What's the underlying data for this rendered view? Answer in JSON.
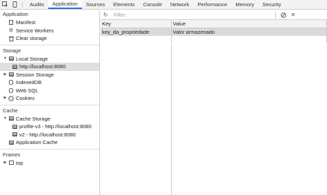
{
  "tabs": [
    "Audits",
    "Application",
    "Sources",
    "Elements",
    "Console",
    "Network",
    "Performance",
    "Memory",
    "Security"
  ],
  "active_tab": "Application",
  "icons": {
    "inspect": "inspect-element-icon",
    "device": "device-toolbar-icon",
    "refresh": "refresh-icon",
    "clear": "clear-block-icon",
    "delete": "close-icon"
  },
  "sidebar": {
    "application": {
      "title": "Application",
      "items": [
        "Manifest",
        "Service Workers",
        "Clear storage"
      ]
    },
    "storage": {
      "title": "Storage",
      "local_storage": "Local Storage",
      "local_storage_child": "http://localhost:8080",
      "session_storage": "Session Storage",
      "indexeddb": "IndexedDB",
      "websql": "Web SQL",
      "cookies": "Cookies"
    },
    "cache": {
      "title": "Cache",
      "cache_storage": "Cache Storage",
      "cache_children": [
        "profile-v3 - http://localhost:8080",
        "v2 - http://localhost:8080"
      ],
      "app_cache": "Application Cache"
    },
    "frames": {
      "title": "Frames",
      "top": "top"
    }
  },
  "toolbar": {
    "filter_placeholder": "Filter"
  },
  "table": {
    "headers": [
      "Key",
      "Value"
    ],
    "rows": [
      {
        "key": "key_da_propriedade",
        "value": "Valor armazenado"
      }
    ]
  },
  "colors": {
    "accent": "#1a73e8",
    "selected_row": "#dadada"
  }
}
